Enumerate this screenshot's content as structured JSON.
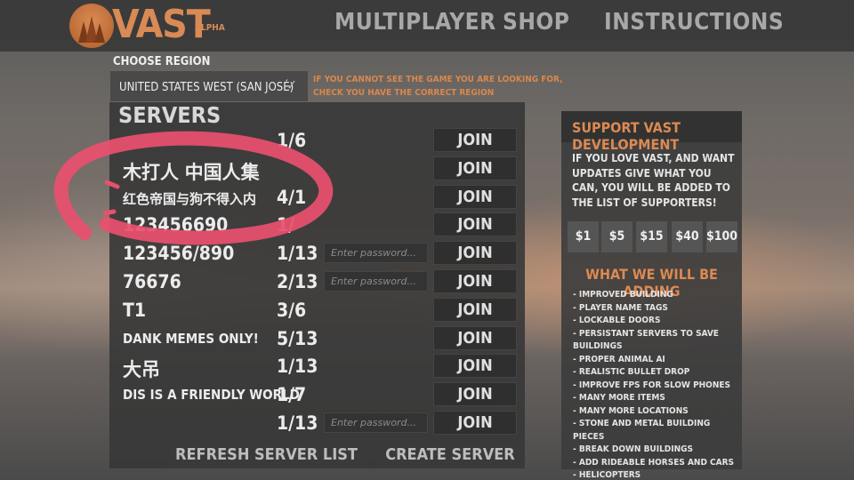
{
  "topbar": {
    "logo_text": "VAST",
    "logo_sub": "ALPHA",
    "nav": [
      "MULTIPLAYER",
      "SHOP",
      "INSTRUCTIONS"
    ]
  },
  "region": {
    "label": "CHOOSE REGION",
    "selected": "UNITED STATES WEST (SAN JOSÉ)",
    "note_line1": "IF YOU CANNOT SEE THE GAME YOU ARE LOOKING FOR,",
    "note_line2": "CHECK YOU HAVE THE CORRECT REGION"
  },
  "servers": {
    "title": "SERVERS",
    "join_label": "JOIN",
    "password_placeholder": "Enter password...",
    "rows": [
      {
        "name": "",
        "count": "1/6",
        "password": false
      },
      {
        "name": "木打人 中国人集",
        "count": "",
        "password": false
      },
      {
        "name": "红色帝国与狗不得入内",
        "count": "4/1",
        "password": false
      },
      {
        "name": "123456690",
        "count": "1/",
        "password": false
      },
      {
        "name": "123456/890",
        "count": "1/13",
        "password": true
      },
      {
        "name": "76676",
        "count": "2/13",
        "password": true
      },
      {
        "name": "T1",
        "count": "3/6",
        "password": false
      },
      {
        "name": "DANK MEMES ONLY!",
        "count": "5/13",
        "password": false
      },
      {
        "name": "大吊",
        "count": "1/13",
        "password": false
      },
      {
        "name": "DIS IS A FRIENDLY WORLD",
        "count": "1/7",
        "password": false
      },
      {
        "name": "",
        "count": "1/13",
        "password": true
      }
    ],
    "refresh_label": "REFRESH SERVER LIST",
    "create_label": "CREATE SERVER"
  },
  "support": {
    "title": "SUPPORT VAST DEVELOPMENT",
    "text": "IF YOU LOVE VAST, AND WANT UPDATES GIVE  WHAT YOU CAN, YOU WILL BE ADDED TO THE LIST OF SUPPORTERS!",
    "donations": [
      "$1",
      "$5",
      "$15",
      "$40",
      "$100"
    ],
    "adding_title": "WHAT WE WILL BE ADDING",
    "features": [
      "- IMPROVED BUILDING",
      "- PLAYER NAME TAGS",
      "- LOCKABLE DOORS",
      "- PERSISTANT SERVERS TO SAVE BUILDINGS",
      "- PROPER ANIMAL AI",
      "- REALISTIC BULLET DROP",
      "- IMPROVE FPS FOR SLOW PHONES",
      "- MANY MORE ITEMS",
      "- MANY MORE LOCATIONS",
      "- STONE AND METAL BUILDING PIECES",
      "- BREAK DOWN BUILDINGS",
      "- ADD RIDEABLE HORSES AND CARS",
      "- HELICOPTERS"
    ]
  },
  "colors": {
    "accent": "#dc8a52",
    "annotation": "#e8506e"
  }
}
